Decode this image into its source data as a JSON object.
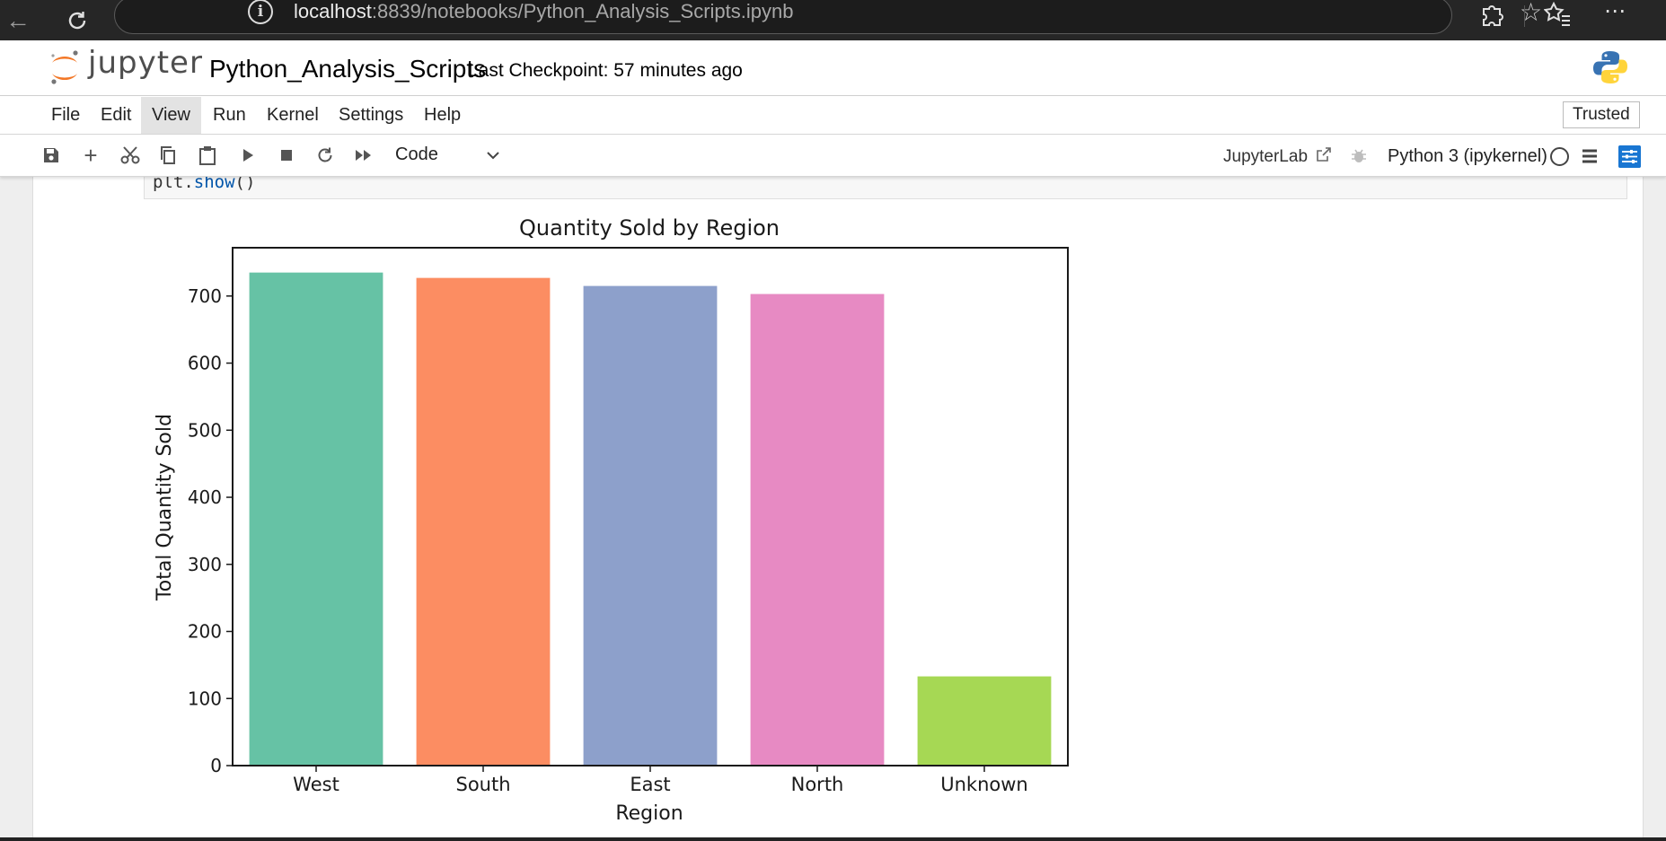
{
  "browser": {
    "url_host": "localhost",
    "url_rest": ":8839/notebooks/Python_Analysis_Scripts.ipynb"
  },
  "header": {
    "logo_text": "jupyter",
    "notebook_title": "Python_Analysis_Scripts",
    "checkpoint": "Last Checkpoint: 57 minutes ago"
  },
  "menu": {
    "items": [
      "File",
      "Edit",
      "View",
      "Run",
      "Kernel",
      "Settings",
      "Help"
    ],
    "active": "View",
    "trusted": "Trusted"
  },
  "toolbar": {
    "icons": [
      "save-icon",
      "add-icon",
      "cut-icon",
      "copy-icon",
      "paste-icon",
      "run-icon",
      "stop-icon",
      "restart-icon",
      "fast-forward-icon"
    ],
    "cell_type": "Code",
    "jupyterlab_link": "JupyterLab",
    "kernel_name": "Python 3 (ipykernel)"
  },
  "cell": {
    "code_obj": "plt.",
    "code_fn": "show",
    "code_tail": "()"
  },
  "colors": {
    "browser_bar": "#262626",
    "accent_blue": "#1976d2",
    "jupyter_orange": "#f37726"
  },
  "chart_data": {
    "type": "bar",
    "title": "Quantity Sold by Region",
    "xlabel": "Region",
    "ylabel": "Total Quantity Sold",
    "categories": [
      "West",
      "South",
      "East",
      "North",
      "Unknown"
    ],
    "values": [
      735,
      727,
      715,
      703,
      133
    ],
    "colors": [
      "#66c2a5",
      "#fc8d62",
      "#8da0cb",
      "#e78ac3",
      "#a6d854"
    ],
    "yticks": [
      0,
      100,
      200,
      300,
      400,
      500,
      600,
      700
    ],
    "ylim": [
      0,
      772
    ],
    "grid": false,
    "legend": "none"
  }
}
